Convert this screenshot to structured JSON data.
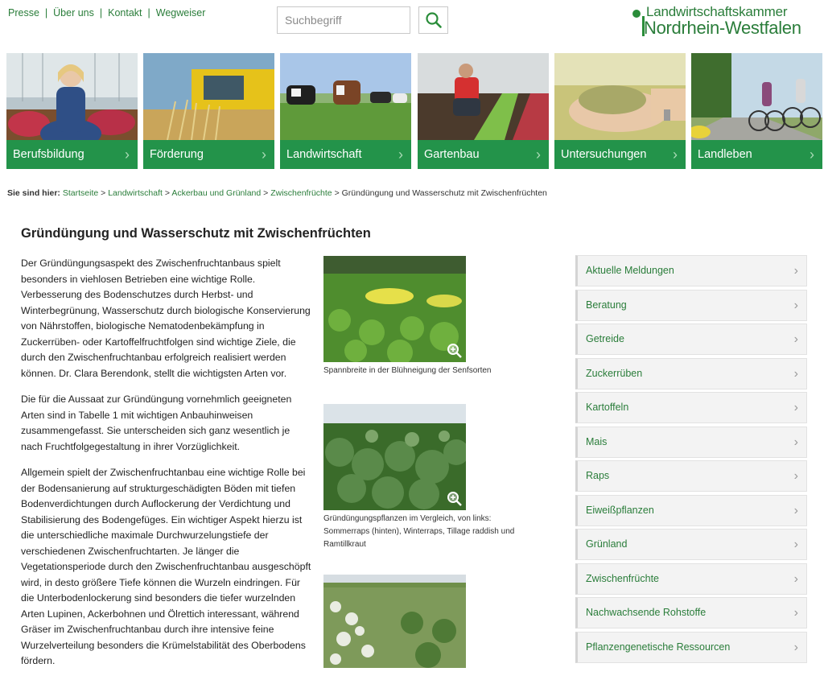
{
  "topnav": {
    "items": [
      "Presse",
      "Über uns",
      "Kontakt",
      "Wegweiser"
    ],
    "separator": "|"
  },
  "search": {
    "placeholder": "Suchbegriff",
    "icon": "search-icon"
  },
  "logo": {
    "line1": "Landwirtschaftskammer",
    "line2": "Nordrhein-Westfalen"
  },
  "tiles": [
    {
      "label": "Berufsbildung"
    },
    {
      "label": "Förderung"
    },
    {
      "label": "Landwirtschaft"
    },
    {
      "label": "Gartenbau"
    },
    {
      "label": "Untersuchungen"
    },
    {
      "label": "Landleben"
    }
  ],
  "chevron": "›",
  "breadcrumb": {
    "prefix": "Sie sind hier:",
    "links": [
      "Startseite",
      "Landwirtschaft",
      "Ackerbau und Grünland",
      "Zwischenfrüchte"
    ],
    "sep": ">",
    "current": "Gründüngung und Wasserschutz mit Zwischenfrüchten"
  },
  "article": {
    "title": "Gründüngung und Wasserschutz mit Zwischenfrüchten",
    "paragraphs": [
      "Der Gründüngungsaspekt des Zwischenfruchtanbaus spielt besonders in viehlosen Betrieben eine wichtige Rolle. Verbesserung des Bodenschutzes durch Herbst- und Winterbegrünung, Wasserschutz durch biologische Konservierung von Nährstoffen, biologische Nematodenbekämpfung in Zuckerrüben- oder Kartoffelfruchtfolgen sind wichtige Ziele, die durch den Zwischenfruchtanbau erfolgreich realisiert werden können. Dr. Clara Berendonk, stellt die wichtigsten Arten vor.",
      "Die für die Aussaat zur Gründüngung vornehmlich geeigneten Arten sind in Tabelle 1 mit wichtigen Anbauhinweisen zusammengefasst. Sie unterscheiden sich ganz wesentlich je nach Fruchtfolgegestaltung in ihrer Vorzüglichkeit.",
      "Allgemein spielt der Zwischenfruchtanbau eine wichtige Rolle bei der Bodensanierung auf strukturgeschädigten Böden mit tiefen Bodenverdichtungen durch Auflockerung der Verdichtung und Stabilisierung des Bodengefüges. Ein wichtiger Aspekt hierzu ist die unterschiedliche maximale Durchwurzelungstiefe der verschiedenen Zwischenfruchtarten. Je länger die Vegetationsperiode durch den Zwischenfruchtanbau ausgeschöpft wird, in desto größere Tiefe können die Wurzeln eindringen. Für die Unterbodenlockerung sind besonders die tiefer wurzelnden Arten Lupinen, Ackerbohnen und Ölrettich interessant, während Gräser im Zwischenfruchtanbau durch ihre intensive feine Wurzelverteilung besonders die Krümelstabilität des Oberbodens fördern."
    ],
    "figures": [
      {
        "caption": "Spannbreite in der Blühneigung der Senfsorten"
      },
      {
        "caption": "Gründüngungspflanzen im Vergleich, von links: Sommerraps (hinten), Winterraps, Tillage raddish und Ramtillkraut"
      },
      {
        "caption": ""
      }
    ]
  },
  "sidebar": {
    "items": [
      "Aktuelle Meldungen",
      "Beratung",
      "Getreide",
      "Zuckerrüben",
      "Kartoffeln",
      "Mais",
      "Raps",
      "Eiweißpflanzen",
      "Grünland",
      "Zwischenfrüchte",
      "Nachwachsende Rohstoffe",
      "Pflanzengenetische Ressourcen"
    ]
  }
}
